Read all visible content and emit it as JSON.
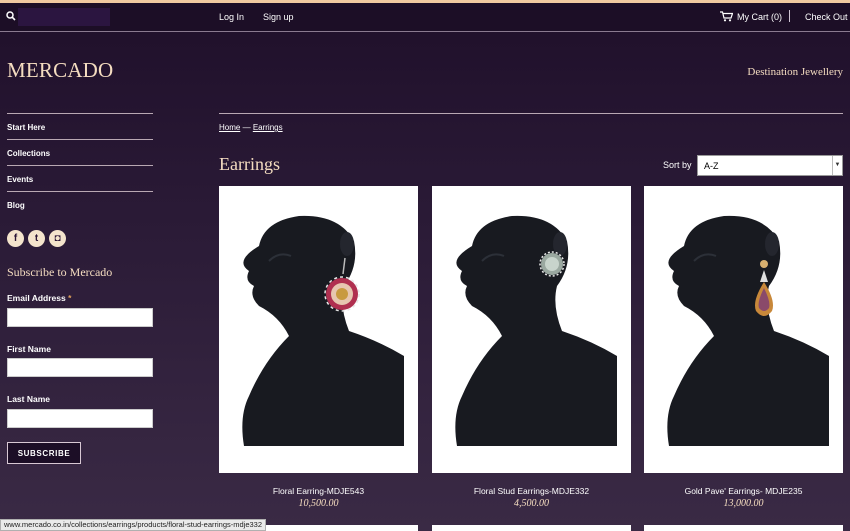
{
  "topbar": {
    "search_placeholder": "",
    "login": "Log In",
    "signup": "Sign up",
    "cart": "My Cart (0)",
    "checkout": "Check Out"
  },
  "brand": {
    "logo": "MERCADO",
    "tagline": "Destination Jewellery"
  },
  "sidebar": {
    "nav": [
      {
        "label": "Start Here"
      },
      {
        "label": "Collections"
      },
      {
        "label": "Events"
      },
      {
        "label": "Blog"
      }
    ],
    "social": [
      {
        "icon": "facebook-icon",
        "glyph": "f"
      },
      {
        "icon": "twitter-icon",
        "glyph": "t"
      },
      {
        "icon": "instagram-icon",
        "glyph": "◘"
      }
    ],
    "subscribe": {
      "title": "Subscribe to Mercado",
      "email_label": "Email Address",
      "required_mark": "*",
      "first_name_label": "First Name",
      "last_name_label": "Last Name",
      "button": "SUBSCRIBE"
    }
  },
  "main": {
    "breadcrumb": {
      "home": "Home",
      "sep": "—",
      "current": "Earrings"
    },
    "title": "Earrings",
    "sort_label": "Sort by",
    "sort_value": "A-Z",
    "products": [
      {
        "name": "Floral Earring-MDJE543",
        "price": "10,500.00",
        "earring": "floral"
      },
      {
        "name": "Floral Stud Earrings-MDJE332",
        "price": "4,500.00",
        "earring": "stud"
      },
      {
        "name": "Gold Pave' Earrings- MDJE235",
        "price": "13,000.00",
        "earring": "drop"
      }
    ]
  },
  "status_bar": "www.mercado.co.in/collections/earrings/products/floral-stud-earrings-mdje332",
  "colors": {
    "background": "#2a1a36",
    "accent": "#f4dcc0",
    "topline": "#f0c9a0"
  }
}
